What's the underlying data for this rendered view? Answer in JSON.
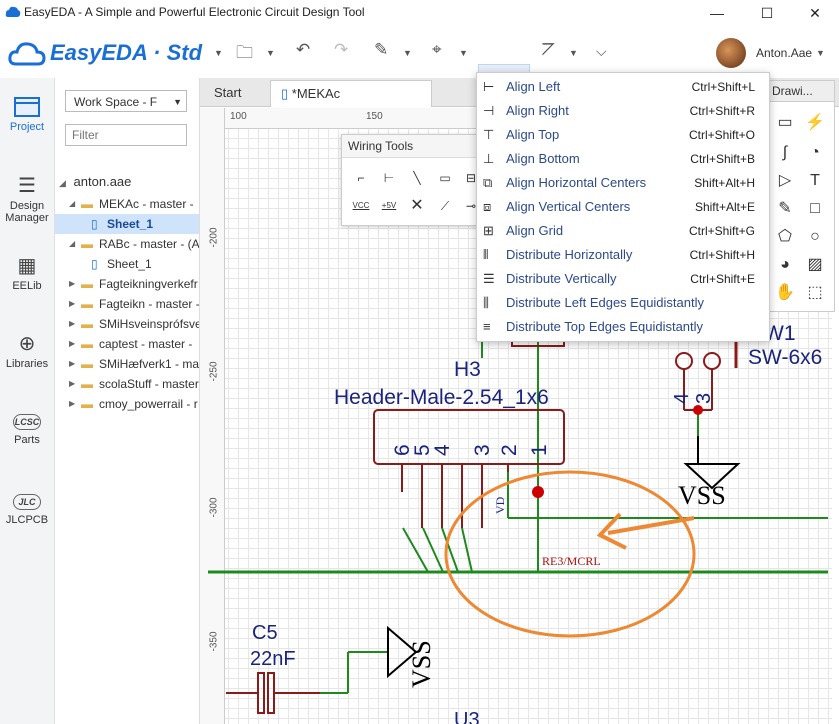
{
  "window": {
    "title": "EasyEDA - A Simple and Powerful Electronic Circuit Design Tool",
    "minimize": "—",
    "maximize": "☐",
    "close": "✕"
  },
  "toolbar": {
    "logo": "EasyEDA · Std",
    "user_name": "Anton.Aae"
  },
  "leftnav": {
    "items": [
      {
        "label": "Project",
        "icon": "folder-icon"
      },
      {
        "label": "Design Manager",
        "icon": "design-manager-icon"
      },
      {
        "label": "EELib",
        "icon": "chip-icon"
      },
      {
        "label": "Libraries",
        "icon": "libraries-icon"
      },
      {
        "label": "Parts",
        "icon": "lcsc-icon",
        "badge": "LCSC"
      },
      {
        "label": "JLCPCB",
        "icon": "jlc-icon",
        "badge": "JLC"
      }
    ]
  },
  "tree": {
    "workspace": "Work Space - F",
    "filter_placeholder": "Filter",
    "root": "anton.aae",
    "rows": [
      {
        "label": "MEKAc - master -",
        "type": "folder",
        "indent": 1,
        "expanded": true
      },
      {
        "label": "Sheet_1",
        "type": "sheet",
        "indent": 2,
        "selected": true
      },
      {
        "label": "RABc - master - (A",
        "type": "folder",
        "indent": 1,
        "expanded": true
      },
      {
        "label": "Sheet_1",
        "type": "sheet",
        "indent": 2
      },
      {
        "label": "Fagteikningverkefr",
        "type": "folder",
        "indent": 1
      },
      {
        "label": "Fagteikn - master -",
        "type": "folder",
        "indent": 1
      },
      {
        "label": "SMiHsveinsprófsve",
        "type": "folder",
        "indent": 1
      },
      {
        "label": "captest - master -",
        "type": "folder",
        "indent": 1
      },
      {
        "label": "SMiHæfverk1 - ma",
        "type": "folder",
        "indent": 1
      },
      {
        "label": "scolaStuff - master",
        "type": "folder",
        "indent": 1
      },
      {
        "label": "cmoy_powerrail - r",
        "type": "folder",
        "indent": 1
      }
    ]
  },
  "tabs": {
    "start": "Start",
    "doc": "*MEKAc"
  },
  "rulers": {
    "h": [
      "100",
      "150"
    ],
    "v": [
      "-200",
      "-250",
      "-300",
      "-350"
    ]
  },
  "wiring_tools": {
    "title": "Wiring Tools",
    "vcc": "VCC",
    "plus5v": "+5V"
  },
  "align_menu": {
    "items": [
      {
        "label": "Align Left",
        "shortcut": "Ctrl+Shift+L",
        "icon": "align-left-icon"
      },
      {
        "label": "Align Right",
        "shortcut": "Ctrl+Shift+R",
        "icon": "align-right-icon"
      },
      {
        "label": "Align Top",
        "shortcut": "Ctrl+Shift+O",
        "icon": "align-top-icon"
      },
      {
        "label": "Align Bottom",
        "shortcut": "Ctrl+Shift+B",
        "icon": "align-bottom-icon"
      },
      {
        "label": "Align Horizontal Centers",
        "shortcut": "Shift+Alt+H",
        "icon": "align-hcenter-icon"
      },
      {
        "label": "Align Vertical Centers",
        "shortcut": "Shift+Alt+E",
        "icon": "align-vcenter-icon"
      },
      {
        "label": "Align Grid",
        "shortcut": "Ctrl+Shift+G",
        "icon": "align-grid-icon"
      },
      {
        "label": "Distribute Horizontally",
        "shortcut": "Ctrl+Shift+H",
        "icon": "distribute-h-icon"
      },
      {
        "label": "Distribute Vertically",
        "shortcut": "Ctrl+Shift+E",
        "icon": "distribute-v-icon"
      },
      {
        "label": "Distribute Left Edges Equidistantly",
        "shortcut": "",
        "icon": "distribute-left-icon"
      },
      {
        "label": "Distribute Top Edges Equidistantly",
        "shortcut": "",
        "icon": "distribute-top-icon"
      }
    ]
  },
  "drawing_panel": {
    "title": "Drawi..."
  },
  "schematic": {
    "h3_ref": "H3",
    "h3_value": "Header-Male-2.54_1x6",
    "pins": [
      "6",
      "5",
      "4",
      "3",
      "2",
      "1"
    ],
    "sw_ref": "W1",
    "sw_value": "SW-6x6",
    "sw_pins": [
      "4",
      "3"
    ],
    "vss1": "VSS",
    "vss2": "VSS",
    "net_vd": "VD",
    "net_re3": "RE3/MCRL",
    "c5_ref": "C5",
    "c5_value": "22nF",
    "u3_ref": "U3"
  },
  "colors": {
    "wire": "#1e8a1e",
    "component": "#8b1a1a",
    "ref_text": "#1a237e",
    "annotation": "#ee8833",
    "junction": "#cc0000",
    "accent": "#1a6fd4"
  }
}
